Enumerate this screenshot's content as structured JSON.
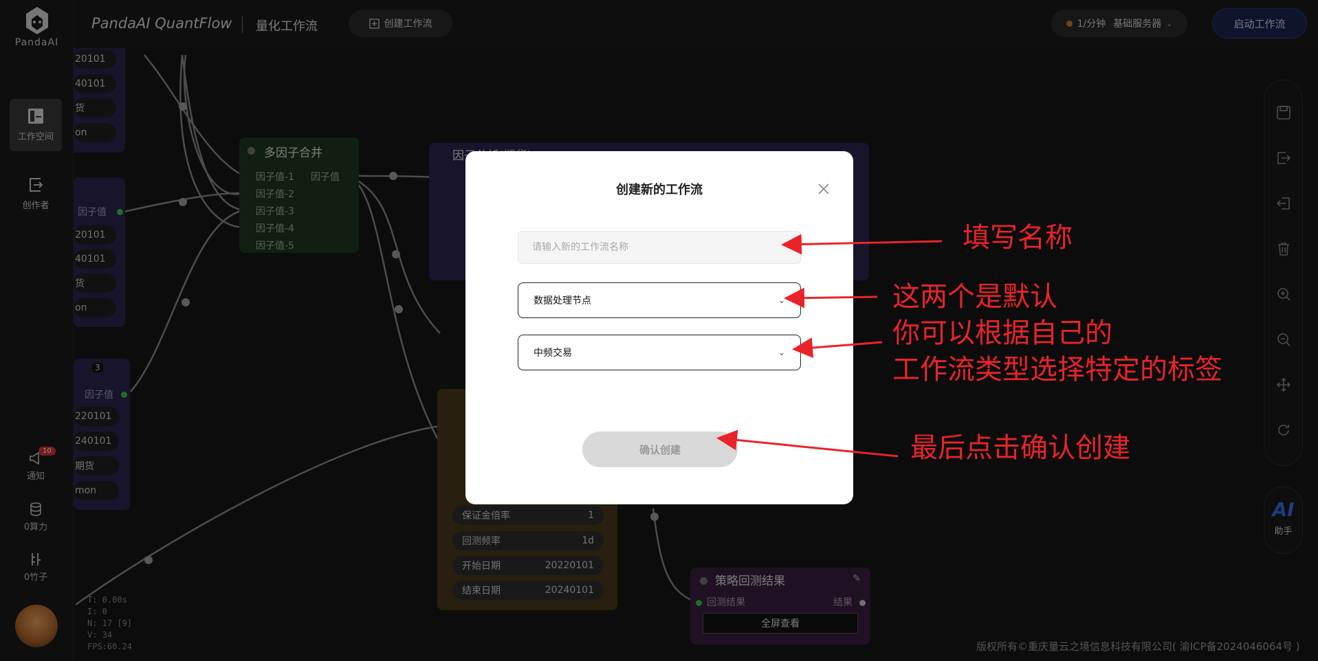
{
  "sidebar": {
    "logo_text": "PandaAI",
    "items": [
      {
        "label": "工作空间",
        "icon": "workspace-icon"
      },
      {
        "label": "创作者",
        "icon": "creator-icon"
      }
    ],
    "notify": {
      "label": "通知",
      "badge": "10",
      "icon": "megaphone-icon"
    },
    "compute": {
      "label": "0算力",
      "icon": "database-icon"
    },
    "bamboo": {
      "label": "0竹子",
      "icon": "bamboo-icon"
    }
  },
  "header": {
    "brand": "PandaAI QuantFlow",
    "subtitle": "量化工作流",
    "create_label": "创建工作流",
    "rate": "1/分钟",
    "server": "基础服务器",
    "start_label": "启动工作流"
  },
  "right_tools": {
    "icons": [
      "save-icon",
      "export-icon",
      "import-icon",
      "trash-icon",
      "zoom-in-icon",
      "zoom-out-icon",
      "move-icon",
      "refresh-icon"
    ],
    "ai_label": "AI",
    "ai_sub": "助手"
  },
  "canvas": {
    "multi_merge": {
      "title": "多因子合并",
      "inputs": [
        "因子值-1",
        "因子值-2",
        "因子值-3",
        "因子值-4",
        "因子值-5"
      ],
      "output": "因子值"
    },
    "factor_analysis": {
      "title": "因子分析(期货)"
    },
    "left_nodes": {
      "top_values": [
        "20101",
        "40101",
        "货",
        "on"
      ],
      "mid_output": "因子值",
      "mid_values": [
        "20101",
        "40101",
        "货",
        "on"
      ],
      "bottom_count": "3",
      "bottom_output": "因子值",
      "bottom_values": [
        "220101",
        "240101",
        "期货",
        "mon"
      ]
    },
    "backtest_config": {
      "rows": [
        {
          "label": "保证金倍率",
          "value": "1"
        },
        {
          "label": "回测频率",
          "value": "1d"
        },
        {
          "label": "开始日期",
          "value": "20220101"
        },
        {
          "label": "结束日期",
          "value": "20240101"
        }
      ]
    },
    "result_node": {
      "title": "策略回测结果",
      "input": "回测结果",
      "output": "结果",
      "button": "全屏查看"
    },
    "stats": [
      "T: 0.00s",
      "I: 0",
      "N: 17 [9]",
      "V: 34",
      "FPS:60.24"
    ]
  },
  "footer": {
    "copyright": "版权所有©重庆量云之境信息科技有限公司( 渝ICP备2024046064号 )"
  },
  "modal": {
    "title": "创建新的工作流",
    "name_placeholder": "请输入新的工作流名称",
    "name_value": "",
    "select1": "数据处理节点",
    "select2": "中频交易",
    "confirm_label": "确认创建"
  },
  "annotations": {
    "a1": "填写名称",
    "a2_line1": "这两个是默认",
    "a2_line2": "你可以根据自己的",
    "a2_line3": "工作流类型选择特定的标签",
    "a3": "最后点击确认创建",
    "color": "#e8242a"
  }
}
